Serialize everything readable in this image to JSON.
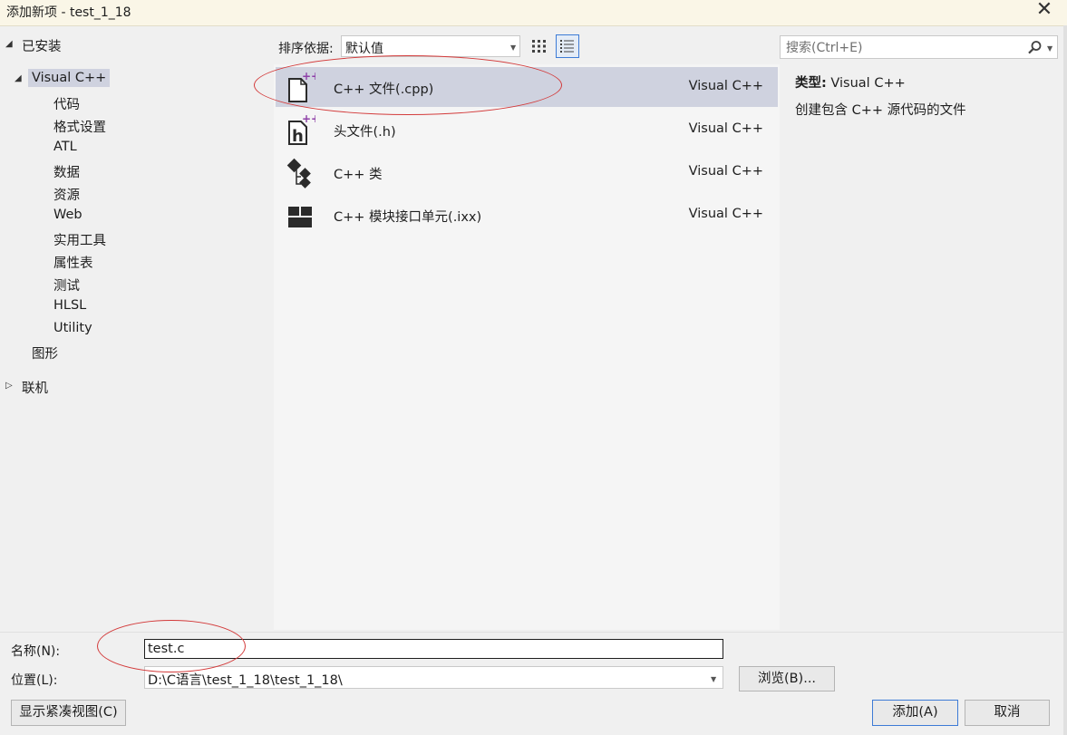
{
  "window": {
    "title": "添加新项 - test_1_18",
    "close_glyph": "✕"
  },
  "tree": {
    "installed_label": "已安装",
    "visual_cpp_label": "Visual C++",
    "children": [
      "代码",
      "格式设置",
      "ATL",
      "数据",
      "资源",
      "Web",
      "实用工具",
      "属性表",
      "测试",
      "HLSL",
      "Utility"
    ],
    "graphics_label": "图形",
    "online_label": "联机",
    "expanded_glyph": "◢",
    "collapsed_glyph": "▷"
  },
  "toolbar": {
    "sort_label": "排序依据:",
    "sort_value": "默认值",
    "grid_view_icon": "grid-icon",
    "list_view_icon": "list-icon"
  },
  "search": {
    "placeholder": "搜索(Ctrl+E)",
    "icon": "search-icon"
  },
  "templates": [
    {
      "name": "C++ 文件(.cpp)",
      "lang": "Visual C++",
      "icon": "cpp-file-icon",
      "selected": true
    },
    {
      "name": "头文件(.h)",
      "lang": "Visual C++",
      "icon": "header-file-icon",
      "selected": false
    },
    {
      "name": "C++ 类",
      "lang": "Visual C++",
      "icon": "cpp-class-icon",
      "selected": false
    },
    {
      "name": "C++ 模块接口单元(.ixx)",
      "lang": "Visual C++",
      "icon": "module-interface-icon",
      "selected": false
    }
  ],
  "details": {
    "type_label": "类型:",
    "type_value": "Visual C++",
    "description": "创建包含 C++ 源代码的文件"
  },
  "form": {
    "name_label": "名称(N):",
    "name_value": "test.c",
    "location_label": "位置(L):",
    "location_value": "D:\\C语言\\test_1_18\\test_1_18\\",
    "browse_label": "浏览(B)..."
  },
  "buttons": {
    "compact_view": "显示紧凑视图(C)",
    "add": "添加(A)",
    "cancel": "取消"
  },
  "colors": {
    "selection": "#cfd2df",
    "accent": "#3d7bd6",
    "annotation": "#d33a3a",
    "icon_plus": "#8e3fa8"
  }
}
